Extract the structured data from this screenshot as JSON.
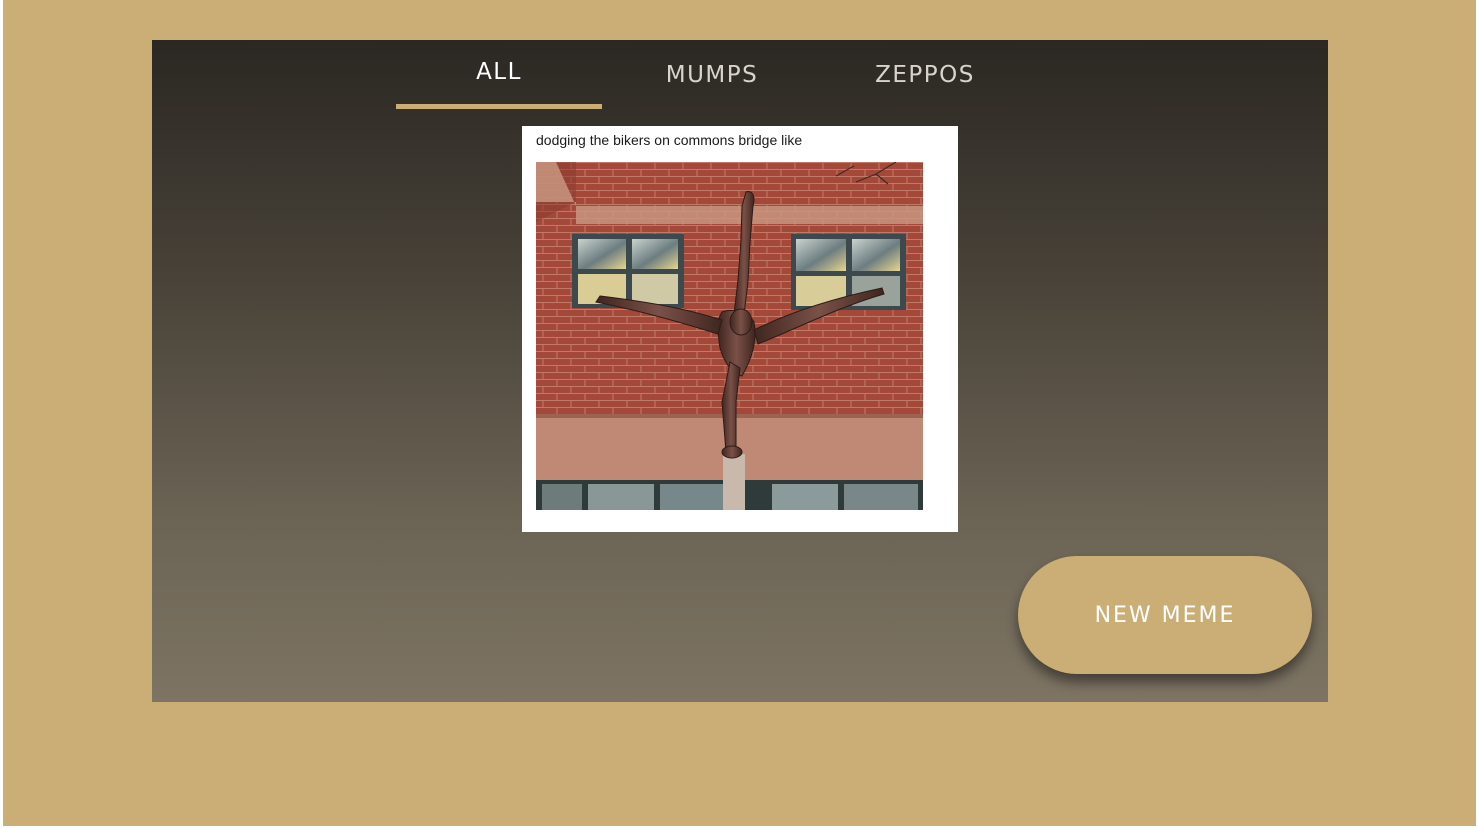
{
  "tabs": [
    {
      "label": "ALL",
      "active": true
    },
    {
      "label": "MUMPS",
      "active": false
    },
    {
      "label": "ZEPPOS",
      "active": false
    }
  ],
  "meme": {
    "caption": "dodging the bikers on commons bridge like"
  },
  "actions": {
    "new_meme_label": "NEW MEME"
  },
  "colors": {
    "page_background": "#cbad76",
    "accent": "#cbad76",
    "panel_top": "#2b2722",
    "panel_bottom": "#7d7463"
  }
}
